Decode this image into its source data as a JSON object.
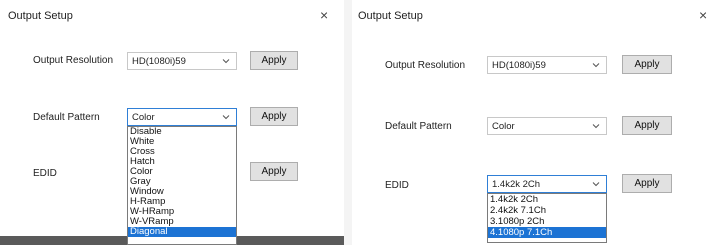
{
  "left_dialog": {
    "title": "Output Setup",
    "close_glyph": "×",
    "output_resolution": {
      "label": "Output Resolution",
      "value": "HD(1080i)59",
      "apply": "Apply"
    },
    "default_pattern": {
      "label": "Default Pattern",
      "value": "Color",
      "apply": "Apply",
      "options": [
        "Disable",
        "White",
        "Cross",
        "Hatch",
        "Color",
        "Gray",
        "Window",
        "H-Ramp",
        "W-HRamp",
        "W-VRamp",
        "Diagonal"
      ],
      "highlighted_option": "Diagonal"
    },
    "edid": {
      "label": "EDID",
      "apply": "Apply"
    }
  },
  "right_dialog": {
    "title": "Output Setup",
    "close_glyph": "×",
    "output_resolution": {
      "label": "Output Resolution",
      "value": "HD(1080i)59",
      "apply": "Apply"
    },
    "default_pattern": {
      "label": "Default Pattern",
      "value": "Color",
      "apply": "Apply"
    },
    "edid": {
      "label": "EDID",
      "value": "1.4k2k 2Ch",
      "apply": "Apply",
      "options": [
        "1.4k2k 2Ch",
        "2.4k2k 7.1Ch",
        "3.1080p 2Ch",
        "4.1080p 7.1Ch"
      ],
      "highlighted_option": "4.1080p 7.1Ch"
    }
  },
  "icons": {
    "close": "close-icon",
    "dropdown": "chevron-down-icon"
  },
  "colors": {
    "selection": "#1c73d4",
    "focus_border": "#2f7fd6",
    "button_face": "#e1e1e1"
  }
}
